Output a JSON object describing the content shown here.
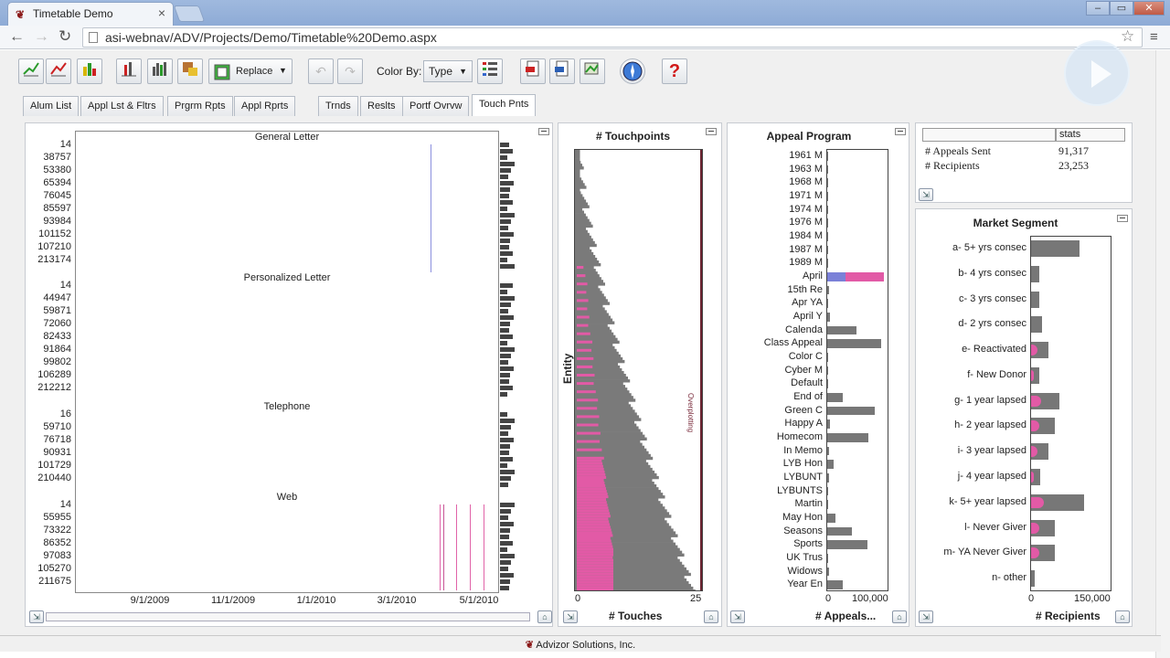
{
  "browser": {
    "tab_title": "Timetable Demo",
    "url": "asi-webnav/ADV/Projects/Demo/Timetable%20Demo.aspx"
  },
  "toolbar": {
    "replace_label": "Replace",
    "color_by_label": "Color By:",
    "color_by_value": "Type"
  },
  "tabs": [
    "Alum List",
    "Appl Lst & Fltrs",
    "Prgrm Rpts",
    "Appl Rprts",
    "Trnds",
    "Reslts",
    "Portf Ovrvw",
    "Touch Pnts"
  ],
  "active_tab": "Touch Pnts",
  "timeline": {
    "groups": [
      {
        "title": "General Letter",
        "ids": [
          "14",
          "38757",
          "53380",
          "65394",
          "76045",
          "85597",
          "93984",
          "101152",
          "107210",
          "213174"
        ]
      },
      {
        "title": "Personalized Letter",
        "ids": [
          "14",
          "44947",
          "59871",
          "72060",
          "82433",
          "91864",
          "99802",
          "106289",
          "212212"
        ]
      },
      {
        "title": "Telephone",
        "ids": [
          "16",
          "59710",
          "76718",
          "90931",
          "101729",
          "210440"
        ]
      },
      {
        "title": "Web",
        "ids": [
          "14",
          "55955",
          "73322",
          "86352",
          "97083",
          "105270",
          "211675"
        ]
      }
    ],
    "x_ticks": [
      "9/1/2009",
      "11/1/2009",
      "1/1/2010",
      "3/1/2010",
      "5/1/2010"
    ]
  },
  "touchpoints": {
    "title": "# Touchpoints",
    "ylabel": "Entity",
    "xlabel": "# Touches",
    "x_min": "0",
    "x_max": "25",
    "annotation": "Overplotting"
  },
  "chart_data": [
    {
      "type": "bar",
      "title": "Appeal Program",
      "xlabel": "# Appeals...",
      "xlim": [
        0,
        150000
      ],
      "tick_labels": [
        "0",
        "100,000"
      ],
      "categories": [
        "1961 M",
        "1963 M",
        "1968 M",
        "1971 M",
        "1974 M",
        "1976 M",
        "1984 M",
        "1987 M",
        "1989 M",
        "April",
        "15th Re",
        "Apr YA",
        "April Y",
        "Calenda",
        "Class Appeal",
        "Color C",
        "Cyber M",
        "Default",
        "End of",
        "Green C",
        "Happy A",
        "Homecom",
        "In Memo",
        "LYB Hon",
        "LYBUNT",
        "LYBUNTS",
        "Martin",
        "May Hon",
        "Seasons",
        "Sports",
        "UK Trus",
        "Widows",
        "Year En"
      ],
      "values": [
        3000,
        3000,
        3000,
        3000,
        3000,
        3000,
        3000,
        3000,
        3000,
        145000,
        4000,
        3000,
        6000,
        75000,
        138000,
        3000,
        3000,
        3000,
        40000,
        122000,
        8000,
        105000,
        5000,
        17000,
        4000,
        3000,
        3000,
        22000,
        62000,
        102000,
        3000,
        5000,
        40000
      ],
      "highlight": {
        "April": 0.33
      }
    },
    {
      "type": "bar",
      "title": "Market Segment",
      "xlabel": "# Recipients",
      "xlim": [
        0,
        200000
      ],
      "tick_labels": [
        "0",
        "150,000"
      ],
      "categories": [
        "a- 5+ yrs consec",
        "b- 4 yrs consec",
        "c- 3 yrs consec",
        "d- 2 yrs consec",
        "e- Reactivated",
        "f- New Donor",
        "g- 1 year lapsed",
        "h- 2 year lapsed",
        "i- 3 year lapsed",
        "j- 4 year lapsed",
        "k- 5+ year lapsed",
        "l- Never Giver",
        "m- YA Never Giver",
        "n- other"
      ],
      "values": [
        120000,
        20000,
        20000,
        28000,
        42000,
        20000,
        70000,
        58000,
        42000,
        22000,
        132000,
        58000,
        60000,
        8000
      ]
    }
  ],
  "stats": {
    "header": "stats",
    "rows": [
      {
        "label": "# Appeals Sent",
        "value": "91,317"
      },
      {
        "label": "# Recipients",
        "value": "23,253"
      }
    ]
  },
  "footer": {
    "text": "Advizor Solutions, Inc."
  },
  "colors": {
    "bar": "#777777",
    "highlight": "#e25aa6",
    "accent": "#7a80d8"
  }
}
